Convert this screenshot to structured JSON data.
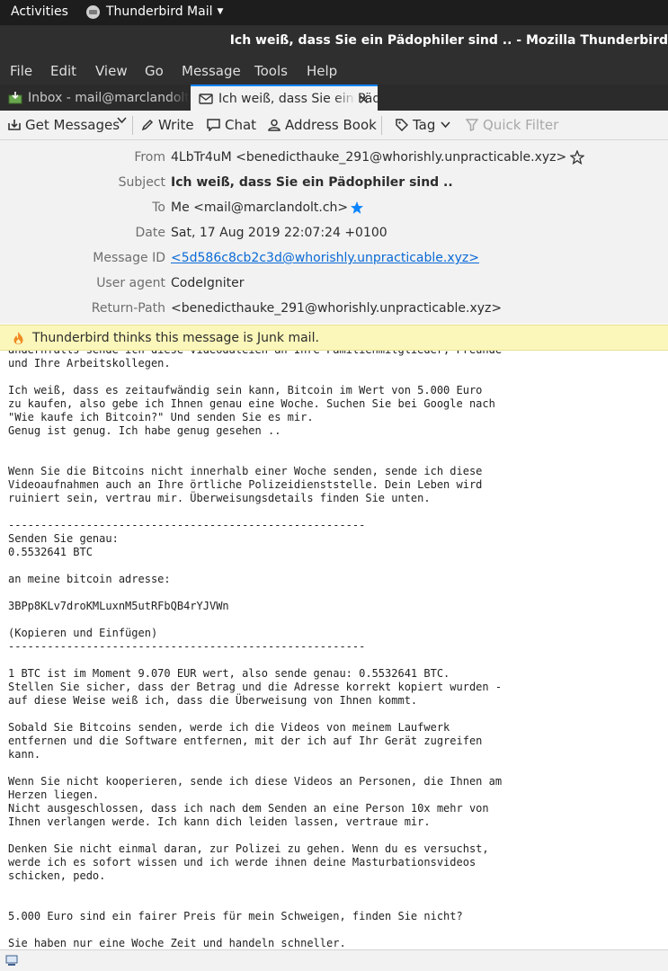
{
  "topbar": {
    "activities": "Activities",
    "app_name": "Thunderbird Mail"
  },
  "window": {
    "title": "Ich weiß, dass Sie ein Pädophiler sind .. - Mozilla Thunderbird"
  },
  "menu": {
    "file": "File",
    "edit": "Edit",
    "view": "View",
    "go": "Go",
    "message": "Message",
    "tools": "Tools",
    "help": "Help"
  },
  "tabs": [
    {
      "label": "Inbox - mail@marclandolt.ch",
      "icon": "inbox-icon"
    },
    {
      "label": "Ich weiß, dass Sie ein Pädophiler sind ..",
      "icon": "envelope-icon"
    }
  ],
  "toolbar": {
    "get_messages": "Get Messages",
    "write": "Write",
    "chat": "Chat",
    "address_book": "Address Book",
    "tag": "Tag",
    "quick_filter": "Quick Filter"
  },
  "headers": {
    "from_label": "From",
    "from_value": "4LbTr4uM <benedicthauke_291@whorishly.unpracticable.xyz>",
    "subject_label": "Subject",
    "subject_value": "Ich weiß, dass Sie ein Pädophiler sind ..",
    "to_label": "To",
    "to_value": "Me <mail@marclandolt.ch>",
    "date_label": "Date",
    "date_value": "Sat, 17 Aug 2019 22:07:24 +0100",
    "message_id_label": "Message ID",
    "message_id_value": "<5d586c8cb2c3d@whorishly.unpracticable.xyz>",
    "user_agent_label": "User agent",
    "user_agent_value": "CodeIgniter",
    "return_path_label": "Return-Path",
    "return_path_value": "<benedicthauke_291@whorishly.unpracticable.xyz>"
  },
  "junk_bar": {
    "text": "Thunderbird thinks this message is Junk mail."
  },
  "body": {
    "text": "andernfalls sende ich diese Videodateien an Ihre Familienmitglieder, Freunde\nund Ihre Arbeitskollegen.\n\nIch weiß, dass es zeitaufwändig sein kann, Bitcoin im Wert von 5.000 Euro\nzu kaufen, also gebe ich Ihnen genau eine Woche. Suchen Sie bei Google nach\n\"Wie kaufe ich Bitcoin?\" Und senden Sie es mir.\nGenug ist genug. Ich habe genug gesehen ..\n\n\nWenn Sie die Bitcoins nicht innerhalb einer Woche senden, sende ich diese\nVideoaufnahmen auch an Ihre örtliche Polizeidienststelle. Dein Leben wird\nruiniert sein, vertrau mir. Überweisungsdetails finden Sie unten.\n\n-------------------------------------------------------\nSenden Sie genau:\n0.5532641 BTC\n\nan meine bitcoin adresse:\n\n3BPp8KLv7droKMLuxnM5utRFbQB4rYJVWn\n\n(Kopieren und Einfügen)\n-------------------------------------------------------\n\n1 BTC ist im Moment 9.070 EUR wert, also sende genau: 0.5532641 BTC.\nStellen Sie sicher, dass der Betrag und die Adresse korrekt kopiert wurden -\nauf diese Weise weiß ich, dass die Überweisung von Ihnen kommt.\n\nSobald Sie Bitcoins senden, werde ich die Videos von meinem Laufwerk\nentfernen und die Software entfernen, mit der ich auf Ihr Gerät zugreifen\nkann.\n\nWenn Sie nicht kooperieren, sende ich diese Videos an Personen, die Ihnen am\nHerzen liegen.\nNicht ausgeschlossen, dass ich nach dem Senden an eine Person 10x mehr von\nIhnen verlangen werde. Ich kann dich leiden lassen, vertraue mir.\n\nDenken Sie nicht einmal daran, zur Polizei zu gehen. Wenn du es versuchst,\nwerde ich es sofort wissen und ich werde ihnen deine Masturbationsvideos\nschicken, pedo.\n\n\n5.000 Euro sind ein fairer Preis für mein Schweigen, finden Sie nicht?\n\nSie haben nur eine Woche Zeit und handeln schneller."
  },
  "colors": {
    "accent": "#0a84ff",
    "junk_bar": "#fbf7ba",
    "dark_chrome": "#2f2f2f",
    "link": "#0a6ad6"
  }
}
